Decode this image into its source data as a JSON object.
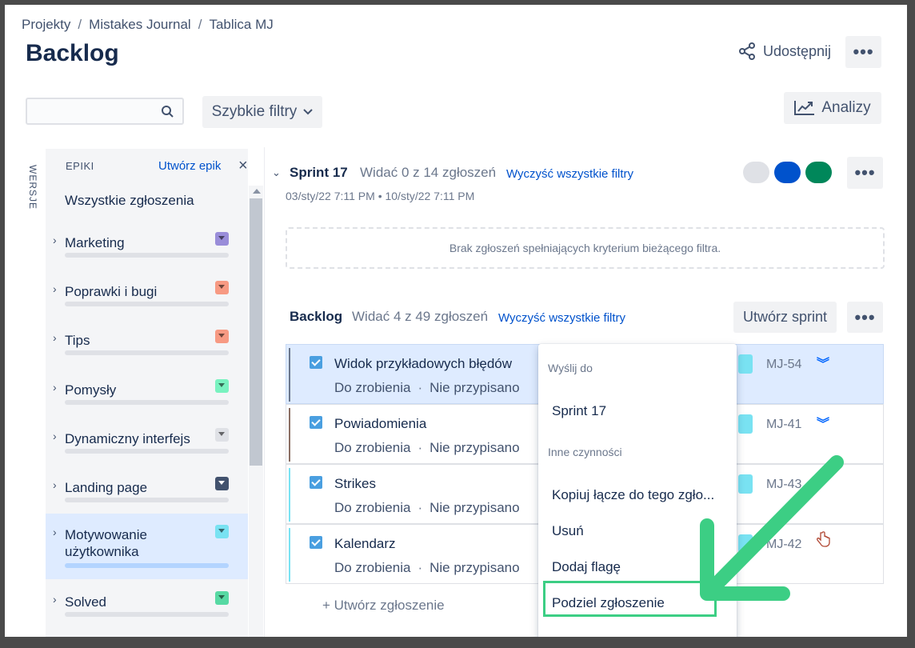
{
  "breadcrumbs": [
    "Projekty",
    "Mistakes Journal",
    "Tablica MJ"
  ],
  "page_title": "Backlog",
  "header": {
    "share_label": "Udostępnij",
    "more_label": "•••"
  },
  "toolbar": {
    "search_value": "",
    "quick_filters_label": "Szybkie filtry",
    "insights_label": "Analizy"
  },
  "versions_tab": "WERSJE",
  "epics_panel": {
    "heading": "EPIKI",
    "create_label": "Utwórz epik",
    "close_label": "×",
    "all_issues": "Wszystkie zgłoszenia",
    "items": [
      {
        "label": "Marketing",
        "color": "#998dd9",
        "selected": false
      },
      {
        "label": "Poprawki i bugi",
        "color": "#f79a83",
        "selected": false
      },
      {
        "label": "Tips",
        "color": "#f79a83",
        "selected": false
      },
      {
        "label": "Pomysły",
        "color": "#79f2c0",
        "selected": false
      },
      {
        "label": "Dynamiczny interfejs",
        "color": "#dfe1e6",
        "selected": false
      },
      {
        "label": "Landing page",
        "color": "#42526e",
        "selected": false
      },
      {
        "label": "Motywowanie użytkownika",
        "color": "#79e2f2",
        "selected": true
      },
      {
        "label": "Solved",
        "color": "#57d9a3",
        "selected": false
      }
    ]
  },
  "sprint": {
    "name": "Sprint 17",
    "count_text": "Widać 0 z 14 zgłoszeń",
    "clear_filters": "Wyczyść wszystkie filtry",
    "dates": "03/sty/22 7:11 PM  •  10/sty/22 7:11 PM",
    "status_colors": [
      "#dfe1e6",
      "#0052cc",
      "#00875a"
    ],
    "empty_text": "Brak zgłoszeń spełniających kryterium bieżącego filtra.",
    "more_label": "•••"
  },
  "backlog": {
    "title": "Backlog",
    "count_text": "Widać 4 z 49 zgłoszeń",
    "clear_filters": "Wyczyść wszystkie filtry",
    "create_sprint": "Utwórz sprint",
    "more_label": "•••",
    "issues": [
      {
        "summary": "Widok przykładowych błędów",
        "status": "Do zrobienia",
        "assignee": "Nie przypisano",
        "key": "MJ-54",
        "epic_color": "#79e2f2",
        "bar_color": "#6b778c",
        "selected": true
      },
      {
        "summary": "Powiadomienia",
        "status": "Do zrobienia",
        "assignee": "Nie przypisano",
        "key": "MJ-41",
        "epic_color": "#79e2f2",
        "bar_color": "#8b6f64",
        "selected": false
      },
      {
        "summary": "Strikes",
        "status": "Do zrobienia",
        "assignee": "Nie przypisano",
        "key": "MJ-43",
        "epic_color": "#79e2f2",
        "bar_color": "#79e2f2",
        "selected": false
      },
      {
        "summary": "Kalendarz",
        "status": "Do zrobienia",
        "assignee": "Nie przypisano",
        "key": "MJ-42",
        "epic_color": "#79e2f2",
        "bar_color": "#79e2f2",
        "selected": false
      }
    ],
    "create_issue": "+  Utwórz zgłoszenie"
  },
  "context_menu": {
    "send_to_heading": "Wyślij do",
    "send_to_item": "Sprint 17",
    "other_heading": "Inne czynności",
    "items": [
      "Kopiuj łącze do tego zgło...",
      "Usuń",
      "Dodaj flagę",
      "Podziel zgłoszenie"
    ]
  },
  "annotation_color": "#3cce84"
}
